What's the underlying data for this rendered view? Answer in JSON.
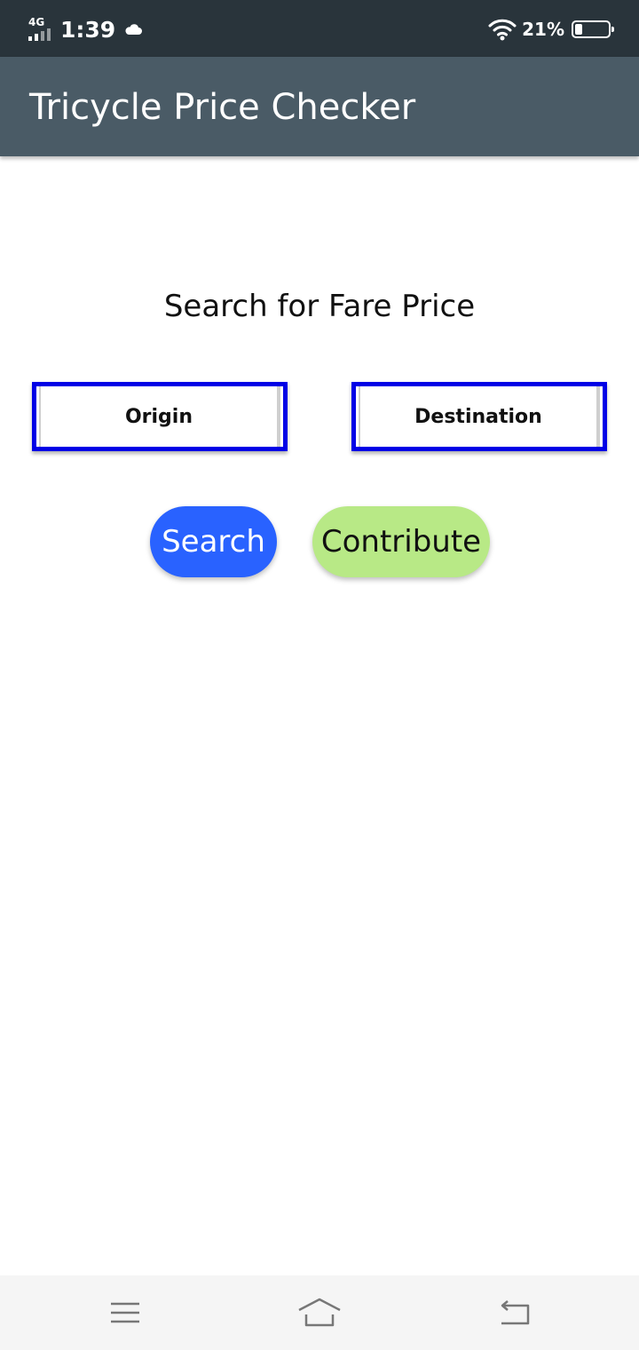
{
  "status_bar": {
    "network": "4G",
    "time": "1:39",
    "battery_percent_label": "21%",
    "battery_level": 0.21,
    "icons": [
      "signal-icon",
      "cloud-icon",
      "wifi-icon",
      "battery-icon"
    ]
  },
  "app_bar": {
    "title": "Tricycle Price Checker",
    "background": "#4a5b66"
  },
  "main": {
    "heading": "Search for Fare Price",
    "origin_field": {
      "label": "Origin",
      "border_color": "#0000e6"
    },
    "destination_field": {
      "label": "Destination",
      "border_color": "#0000e6"
    },
    "search_button": {
      "label": "Search",
      "color": "#2962ff"
    },
    "contribute_button": {
      "label": "Contribute",
      "color": "#b8e986"
    }
  },
  "nav_bar": {
    "icons": [
      "menu-icon",
      "home-icon",
      "back-icon"
    ]
  }
}
